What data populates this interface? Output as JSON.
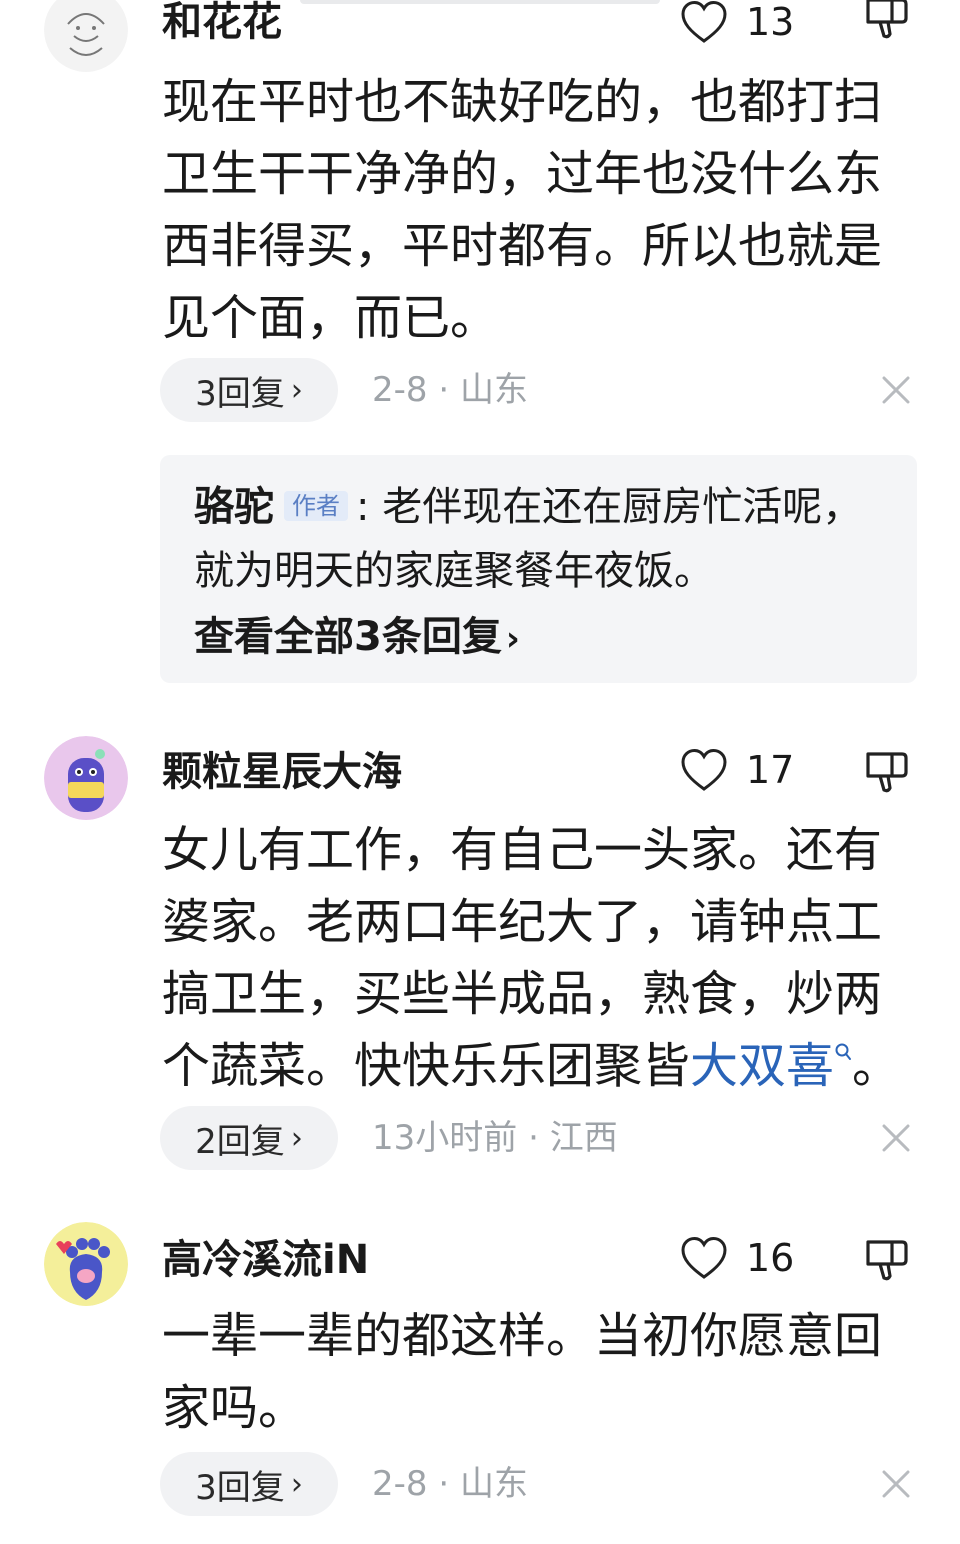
{
  "comments": [
    {
      "username": "和花花",
      "likes": "13",
      "text": "现在平时也不缺好吃的，也都打扫卫生干干净净的，过年也没什么东西非得买，平时都有。所以也就是见个面，而已。",
      "reply_button": "3回复",
      "date": "2-8",
      "location": "山东",
      "sub_reply": {
        "author": "骆驼",
        "author_tag": "作者",
        "separator": ":",
        "text": "老伴现在还在厨房忙活呢，就为明天的家庭聚餐年夜饭。",
        "view_all": "查看全部3条回复"
      }
    },
    {
      "username": "颗粒星辰大海",
      "likes": "17",
      "text_before_link": "女儿有工作，有自己一头家。还有婆家。老两口年纪大了，请钟点工搞卫生，买些半成品，熟食，炒两个蔬菜。快快乐乐团聚皆",
      "link_text": "大双喜",
      "link_icon": "search-icon",
      "text_after_link": "。",
      "reply_button": "2回复",
      "date": "13小时前",
      "location": "江西"
    },
    {
      "username": "高冷溪流iN",
      "likes": "16",
      "text": "一辈一辈的都这样。当初你愿意回家吗。",
      "reply_button": "3回复",
      "date": "2-8",
      "location": "山东"
    }
  ],
  "meta_separator": "·",
  "colors": {
    "link": "#2a64b8",
    "meta": "#9ea3a8",
    "pill_bg": "#f1f2f4",
    "subreply_bg": "#f4f5f7",
    "author_tag": "#5a7fc4"
  },
  "icons": {
    "like": "heart-outline-icon",
    "dislike": "thumbs-down-icon",
    "close": "close-icon",
    "chevron": "chevron-right-icon"
  }
}
